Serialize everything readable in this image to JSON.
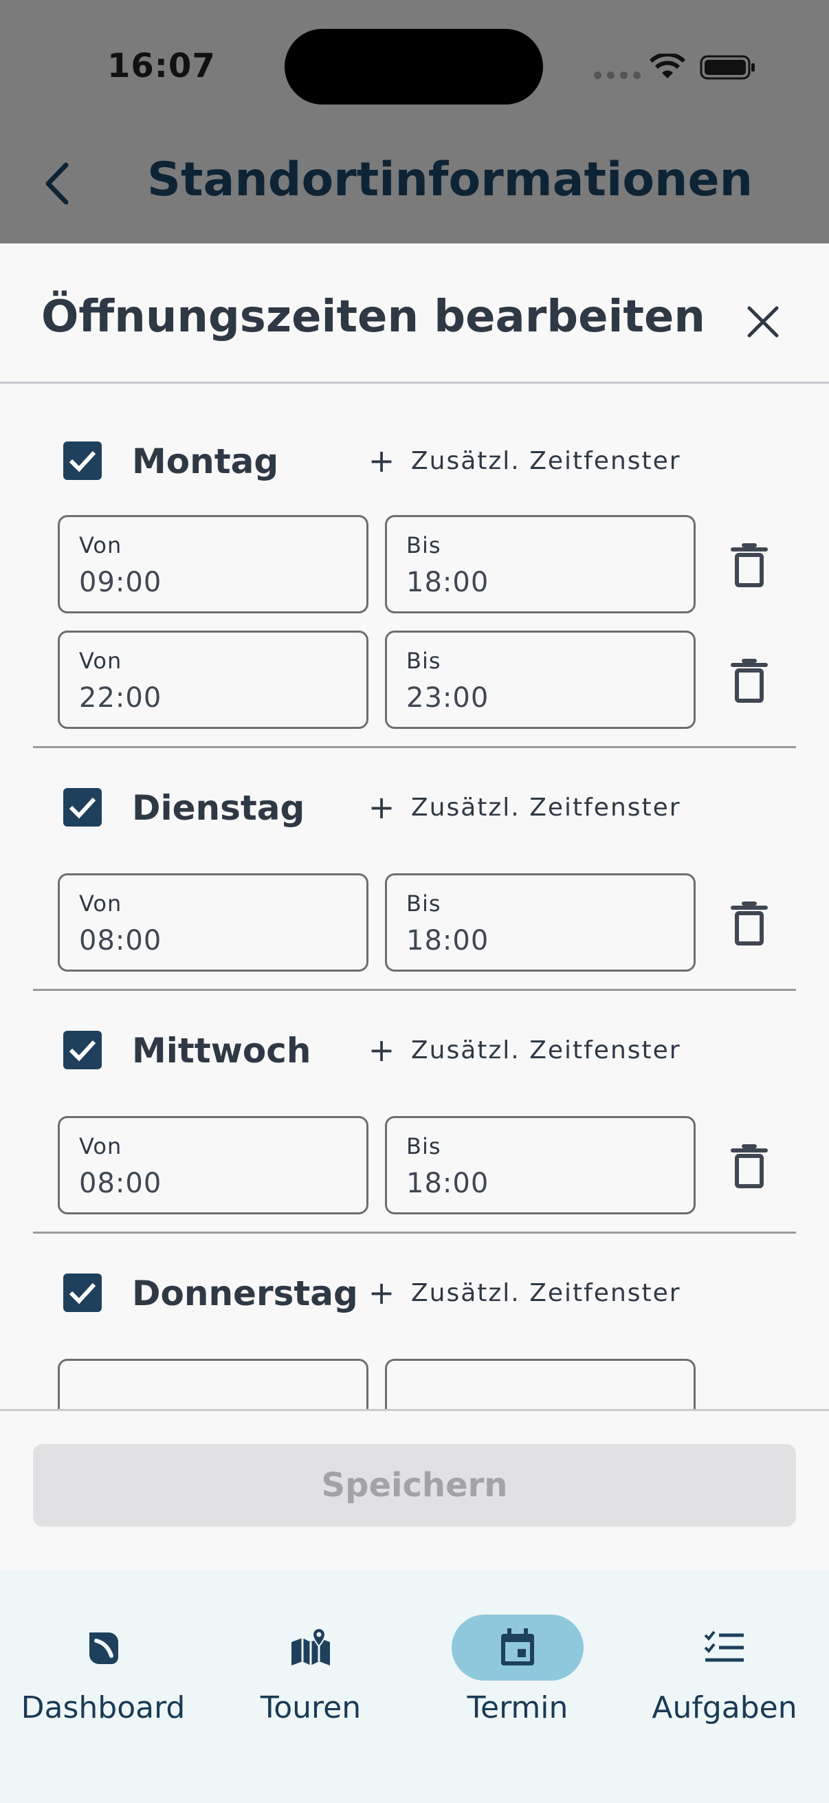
{
  "status_bar": {
    "time": "16:07"
  },
  "app_bar": {
    "title": "Standortinformationen"
  },
  "sheet": {
    "title": "Öffnungszeiten bearbeiten",
    "add_slot_label": "Zusätzl. Zeitfenster",
    "from_label": "Von",
    "to_label": "Bis",
    "days": [
      {
        "name": "Montag",
        "checked": true,
        "slots": [
          {
            "from": "09:00",
            "to": "18:00"
          },
          {
            "from": "22:00",
            "to": "23:00"
          }
        ]
      },
      {
        "name": "Dienstag",
        "checked": true,
        "slots": [
          {
            "from": "08:00",
            "to": "18:00"
          }
        ]
      },
      {
        "name": "Mittwoch",
        "checked": true,
        "slots": [
          {
            "from": "08:00",
            "to": "18:00"
          }
        ]
      },
      {
        "name": "Donnerstag",
        "checked": true,
        "slots": []
      }
    ],
    "save_label": "Speichern"
  },
  "bottom_nav": {
    "items": [
      {
        "label": "Dashboard",
        "icon": "dashboard-icon",
        "active": false
      },
      {
        "label": "Touren",
        "icon": "map-icon",
        "active": false
      },
      {
        "label": "Termin",
        "icon": "calendar-icon",
        "active": true
      },
      {
        "label": "Aufgaben",
        "icon": "checklist-icon",
        "active": false
      }
    ]
  },
  "colors": {
    "accent": "#1e405c",
    "active_pill": "#8fc8dc",
    "text_dark": "#2f3945"
  }
}
